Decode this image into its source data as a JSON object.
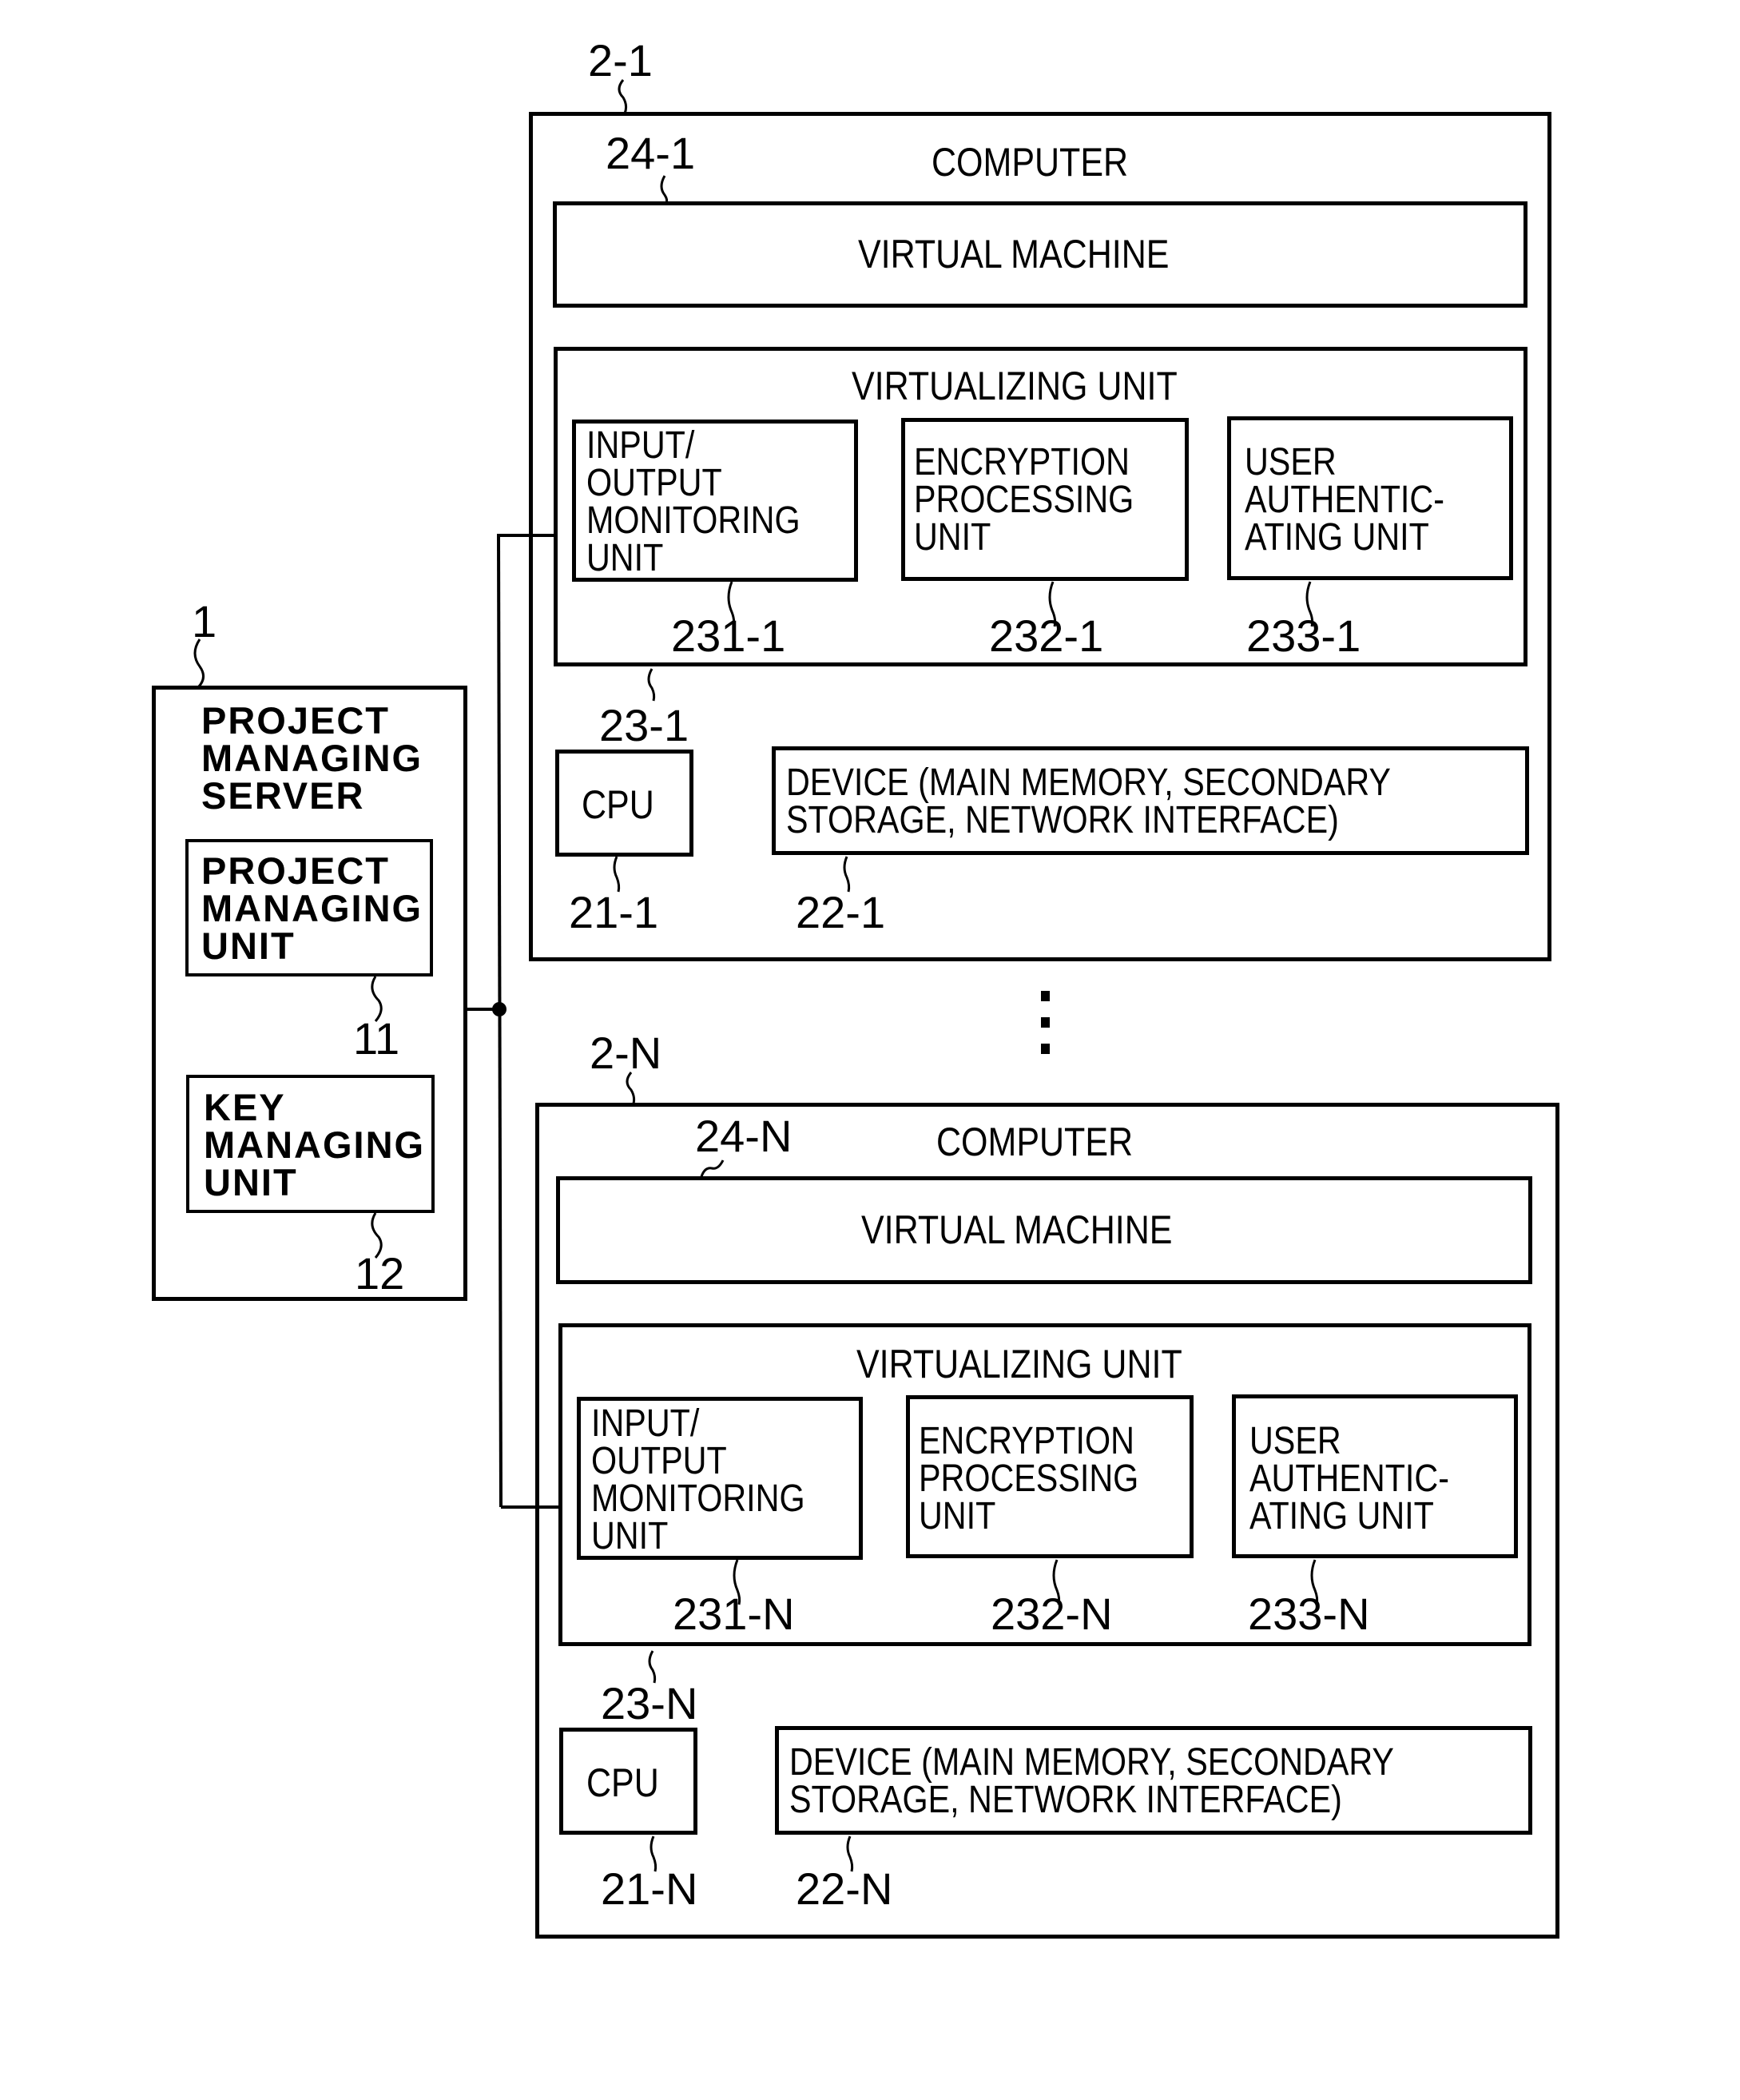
{
  "server": {
    "ref": "1",
    "title": "PROJECT\nMANAGING\nSERVER",
    "units": [
      {
        "ref": "11",
        "label": "PROJECT\nMANAGING\nUNIT"
      },
      {
        "ref": "12",
        "label": "KEY\nMANAGING\nUNIT"
      }
    ]
  },
  "computers": [
    {
      "ref": "2-1",
      "title": "COMPUTER",
      "virtual_machine": {
        "ref": "24-1",
        "label": "VIRTUAL MACHINE"
      },
      "virtualizing_unit": {
        "ref": "23-1",
        "label": "VIRTUALIZING UNIT",
        "units": [
          {
            "ref": "231-1",
            "label": "INPUT/\nOUTPUT\nMONITORING\nUNIT"
          },
          {
            "ref": "232-1",
            "label": "ENCRYPTION\nPROCESSING\nUNIT"
          },
          {
            "ref": "233-1",
            "label": "USER\nAUTHENTIC-\nATING UNIT"
          }
        ]
      },
      "cpu": {
        "ref": "21-1",
        "label": "CPU"
      },
      "device": {
        "ref": "22-1",
        "label": "DEVICE (MAIN MEMORY, SECONDARY\nSTORAGE, NETWORK INTERFACE)"
      }
    },
    {
      "ref": "2-N",
      "title": "COMPUTER",
      "virtual_machine": {
        "ref": "24-N",
        "label": "VIRTUAL MACHINE"
      },
      "virtualizing_unit": {
        "ref": "23-N",
        "label": "VIRTUALIZING UNIT",
        "units": [
          {
            "ref": "231-N",
            "label": "INPUT/\nOUTPUT\nMONITORING\nUNIT"
          },
          {
            "ref": "232-N",
            "label": "ENCRYPTION\nPROCESSING\nUNIT"
          },
          {
            "ref": "233-N",
            "label": "USER\nAUTHENTIC-\nATING UNIT"
          }
        ]
      },
      "cpu": {
        "ref": "21-N",
        "label": "CPU"
      },
      "device": {
        "ref": "22-N",
        "label": "DEVICE (MAIN MEMORY, SECONDARY\nSTORAGE, NETWORK INTERFACE)"
      }
    }
  ],
  "ellipsis": "⋮"
}
